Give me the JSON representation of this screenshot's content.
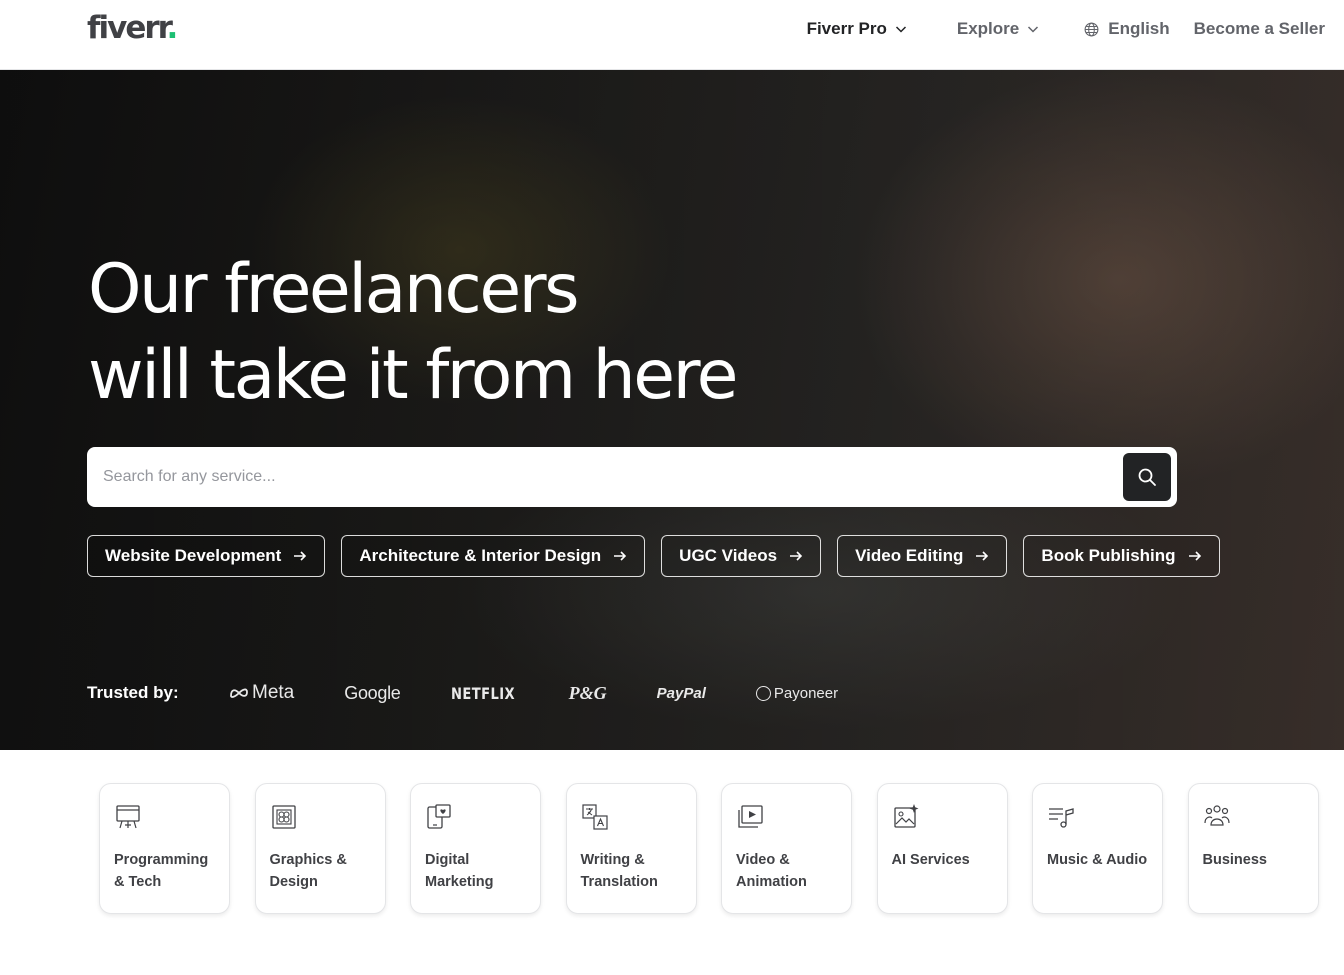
{
  "header": {
    "logo_text": "fiverr",
    "logo_dot": ".",
    "nav": {
      "pro": "Fiverr Pro",
      "explore": "Explore",
      "language": "English",
      "become_seller": "Become a Seller"
    }
  },
  "hero": {
    "title_line1": "Our freelancers",
    "title_line2": "will take it from here",
    "search": {
      "placeholder": "Search for any service..."
    },
    "chips": [
      "Website Development",
      "Architecture & Interior Design",
      "UGC Videos",
      "Video Editing",
      "Book Publishing"
    ],
    "trusted": {
      "label": "Trusted by:",
      "brands": [
        "Meta",
        "Google",
        "NETFLIX",
        "P&G",
        "PayPal",
        "Payoneer"
      ]
    }
  },
  "categories": [
    {
      "label": "Programming\n& Tech",
      "icon": "programming-icon"
    },
    {
      "label": "Graphics &\nDesign",
      "icon": "graphics-design-icon"
    },
    {
      "label": "Digital\nMarketing",
      "icon": "digital-marketing-icon"
    },
    {
      "label": "Writing &\nTranslation",
      "icon": "writing-translation-icon"
    },
    {
      "label": "Video &\nAnimation",
      "icon": "video-animation-icon"
    },
    {
      "label": "AI Services",
      "icon": "ai-services-icon"
    },
    {
      "label": "Music & Audio",
      "icon": "music-audio-icon"
    },
    {
      "label": "Business",
      "icon": "business-icon"
    }
  ],
  "colors": {
    "brand_green": "#1dbf73",
    "text_dark": "#222325",
    "text_muted": "#62646a"
  }
}
